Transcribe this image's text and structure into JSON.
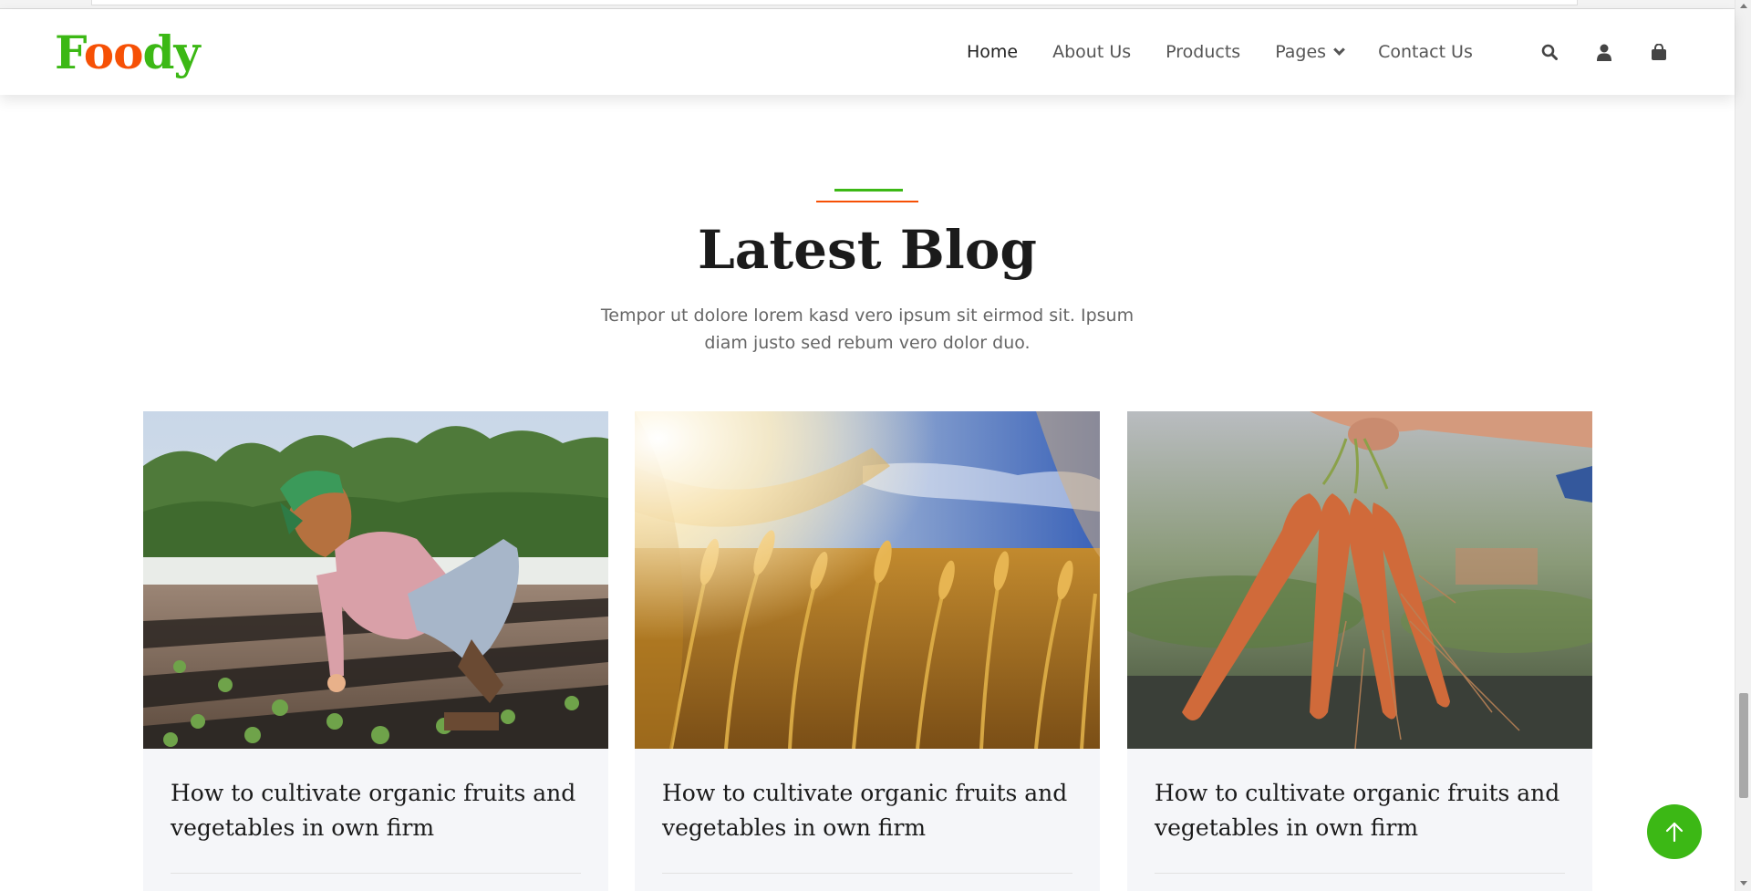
{
  "brand": {
    "part1": "Foo",
    "part2": "dy",
    "letters": [
      "F",
      "o",
      "o",
      "d",
      "y"
    ]
  },
  "nav": {
    "items": [
      {
        "label": "Home",
        "active": true
      },
      {
        "label": "About Us"
      },
      {
        "label": "Products"
      },
      {
        "label": "Pages",
        "dropdown": true
      },
      {
        "label": "Contact Us"
      }
    ],
    "icons": [
      "search-icon",
      "user-icon",
      "shopping-bag-icon"
    ]
  },
  "section": {
    "title": "Latest Blog",
    "subtitle": "Tempor ut dolore lorem kasd vero ipsum sit eirmod sit. Ipsum diam justo sed rebum vero dolor duo."
  },
  "blog": {
    "posts": [
      {
        "title": "How to cultivate organic fruits and vegetables in own firm",
        "image": "farmer-planting-seedlings"
      },
      {
        "title": "How to cultivate organic fruits and vegetables in own firm",
        "image": "wheat-field"
      },
      {
        "title": "How to cultivate organic fruits and vegetables in own firm",
        "image": "hand-holding-carrots"
      }
    ]
  },
  "colors": {
    "primary": "#3cb815",
    "secondary": "#f65005",
    "heading": "#1b1b1b",
    "card_bg": "#f5f6f9"
  },
  "back_to_top": {
    "icon": "arrow-up-icon"
  }
}
